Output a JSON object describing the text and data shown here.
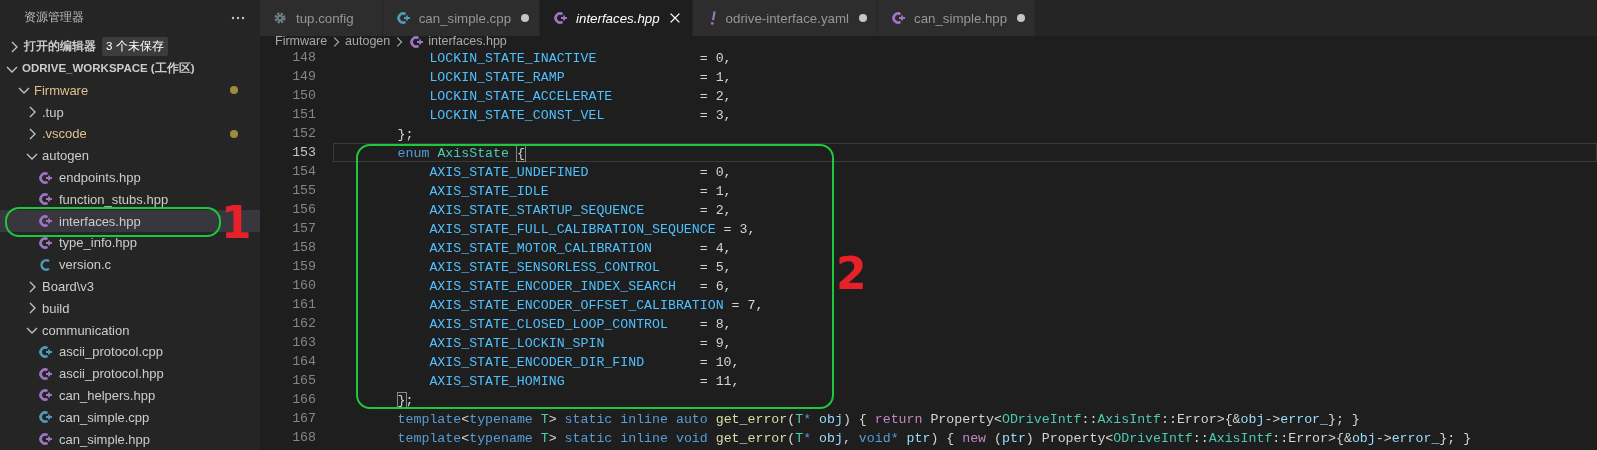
{
  "sidebar": {
    "title": "资源管理器",
    "open_editors": {
      "label": "打开的编辑器",
      "expanded": false,
      "badge": "3 个未保存"
    },
    "tree": [
      {
        "label": "ODRIVE_WORKSPACE (工作区)",
        "kind": "root",
        "expanded": true,
        "selected": false,
        "modified": false,
        "children": [
          {
            "label": "Firmware",
            "kind": "folder",
            "expanded": true,
            "selected": false,
            "modified": true,
            "children": [
              {
                "label": ".tup",
                "kind": "folder",
                "expanded": false,
                "selected": false,
                "modified": false
              },
              {
                "label": ".vscode",
                "kind": "folder",
                "expanded": false,
                "selected": false,
                "modified": true
              },
              {
                "label": "autogen",
                "kind": "folder",
                "expanded": true,
                "selected": false,
                "modified": false,
                "children": [
                  {
                    "label": "endpoints.hpp",
                    "kind": "hpp",
                    "selected": false,
                    "modified": false
                  },
                  {
                    "label": "function_stubs.hpp",
                    "kind": "hpp",
                    "selected": false,
                    "modified": false
                  },
                  {
                    "label": "interfaces.hpp",
                    "kind": "hpp",
                    "selected": true,
                    "modified": false
                  },
                  {
                    "label": "type_info.hpp",
                    "kind": "hpp",
                    "selected": false,
                    "modified": false
                  },
                  {
                    "label": "version.c",
                    "kind": "c",
                    "selected": false,
                    "modified": false
                  }
                ]
              },
              {
                "label": "Board\\v3",
                "kind": "folder",
                "expanded": false,
                "selected": false,
                "modified": false
              },
              {
                "label": "build",
                "kind": "folder",
                "expanded": false,
                "selected": false,
                "modified": false
              },
              {
                "label": "communication",
                "kind": "folder",
                "expanded": true,
                "selected": false,
                "modified": false,
                "children": [
                  {
                    "label": "ascii_protocol.cpp",
                    "kind": "cpp",
                    "selected": false,
                    "modified": false
                  },
                  {
                    "label": "ascii_protocol.hpp",
                    "kind": "hpp",
                    "selected": false,
                    "modified": false
                  },
                  {
                    "label": "can_helpers.hpp",
                    "kind": "hpp",
                    "selected": false,
                    "modified": false
                  },
                  {
                    "label": "can_simple.cpp",
                    "kind": "cpp",
                    "selected": false,
                    "modified": false
                  },
                  {
                    "label": "can_simple.hpp",
                    "kind": "hpp",
                    "selected": false,
                    "modified": false
                  }
                ]
              }
            ]
          }
        ]
      }
    ]
  },
  "tabs": [
    {
      "label": "tup.config",
      "kind": "config",
      "selected": false,
      "modified": false,
      "preview": false
    },
    {
      "label": "can_simple.cpp",
      "kind": "cpp",
      "selected": false,
      "modified": true,
      "preview": false
    },
    {
      "label": "interfaces.hpp",
      "kind": "hpp",
      "selected": true,
      "modified": false,
      "preview": true
    },
    {
      "label": "odrive-interface.yaml",
      "kind": "yaml",
      "selected": false,
      "modified": true,
      "preview": false
    },
    {
      "label": "can_simple.hpp",
      "kind": "hpp",
      "selected": false,
      "modified": true,
      "preview": false
    }
  ],
  "breadcrumb": [
    {
      "label": "Firmware"
    },
    {
      "label": "autogen"
    },
    {
      "label": "interfaces.hpp",
      "kind": "hpp"
    }
  ],
  "code": {
    "lines": [
      {
        "n": "148",
        "kind": "member",
        "current": false,
        "name": "LOCKIN_STATE_INACTIVE",
        "value": "= 0,"
      },
      {
        "n": "149",
        "kind": "member",
        "current": false,
        "name": "LOCKIN_STATE_RAMP",
        "value": "= 1,"
      },
      {
        "n": "150",
        "kind": "member",
        "current": false,
        "name": "LOCKIN_STATE_ACCELERATE",
        "value": "= 2,"
      },
      {
        "n": "151",
        "kind": "member",
        "current": false,
        "name": "LOCKIN_STATE_CONST_VEL",
        "value": "= 3,"
      },
      {
        "n": "152",
        "kind": "block",
        "current": false,
        "tokens": [
          {
            "kind": "plain",
            "text": "};"
          }
        ]
      },
      {
        "n": "153",
        "kind": "block",
        "current": true,
        "tokens": [
          {
            "kind": "kw",
            "text": "enum "
          },
          {
            "kind": "type",
            "text": "AxisState "
          },
          {
            "kind": "bracket",
            "text": "{"
          }
        ]
      },
      {
        "n": "154",
        "kind": "member",
        "current": false,
        "name": "AXIS_STATE_UNDEFINED",
        "value": "= 0,"
      },
      {
        "n": "155",
        "kind": "member",
        "current": false,
        "name": "AXIS_STATE_IDLE",
        "value": "= 1,"
      },
      {
        "n": "156",
        "kind": "member",
        "current": false,
        "name": "AXIS_STATE_STARTUP_SEQUENCE",
        "value": "= 2,"
      },
      {
        "n": "157",
        "kind": "member",
        "current": false,
        "name": "AXIS_STATE_FULL_CALIBRATION_SEQUENCE",
        "value": "= 3,"
      },
      {
        "n": "158",
        "kind": "member",
        "current": false,
        "name": "AXIS_STATE_MOTOR_CALIBRATION",
        "value": "= 4,"
      },
      {
        "n": "159",
        "kind": "member",
        "current": false,
        "name": "AXIS_STATE_SENSORLESS_CONTROL",
        "value": "= 5,"
      },
      {
        "n": "160",
        "kind": "member",
        "current": false,
        "name": "AXIS_STATE_ENCODER_INDEX_SEARCH",
        "value": "= 6,"
      },
      {
        "n": "161",
        "kind": "member",
        "current": false,
        "name": "AXIS_STATE_ENCODER_OFFSET_CALIBRATION",
        "value": "= 7,"
      },
      {
        "n": "162",
        "kind": "member",
        "current": false,
        "name": "AXIS_STATE_CLOSED_LOOP_CONTROL",
        "value": "= 8,"
      },
      {
        "n": "163",
        "kind": "member",
        "current": false,
        "name": "AXIS_STATE_LOCKIN_SPIN",
        "value": "= 9,"
      },
      {
        "n": "164",
        "kind": "member",
        "current": false,
        "name": "AXIS_STATE_ENCODER_DIR_FIND",
        "value": "= 10,"
      },
      {
        "n": "165",
        "kind": "member",
        "current": false,
        "name": "AXIS_STATE_HOMING",
        "value": "= 11,"
      },
      {
        "n": "166",
        "kind": "block",
        "current": false,
        "tokens": [
          {
            "kind": "bracket",
            "text": "}"
          },
          {
            "kind": "plain",
            "text": ";"
          }
        ]
      },
      {
        "n": "167",
        "kind": "block",
        "current": false,
        "tokens": [
          {
            "kind": "kw",
            "text": "template"
          },
          {
            "kind": "plain",
            "text": "<"
          },
          {
            "kind": "kw",
            "text": "typename "
          },
          {
            "kind": "type",
            "text": "T"
          },
          {
            "kind": "plain",
            "text": "> "
          },
          {
            "kind": "kw",
            "text": "static inline auto "
          },
          {
            "kind": "func",
            "text": "get_error"
          },
          {
            "kind": "plain",
            "text": "("
          },
          {
            "kind": "type",
            "text": "T"
          },
          {
            "kind": "kw",
            "text": "* "
          },
          {
            "kind": "param",
            "text": "obj"
          },
          {
            "kind": "plain",
            "text": ") { "
          },
          {
            "kind": "ctrl",
            "text": "return "
          },
          {
            "kind": "plain",
            "text": "Property<"
          },
          {
            "kind": "type",
            "text": "ODriveIntf"
          },
          {
            "kind": "plain",
            "text": "::"
          },
          {
            "kind": "type",
            "text": "AxisIntf"
          },
          {
            "kind": "plain",
            "text": "::Error>{&"
          },
          {
            "kind": "param",
            "text": "obj"
          },
          {
            "kind": "plain",
            "text": "->"
          },
          {
            "kind": "param",
            "text": "error_"
          },
          {
            "kind": "plain",
            "text": "}; }"
          }
        ]
      },
      {
        "n": "168",
        "kind": "block",
        "current": false,
        "tokens": [
          {
            "kind": "kw",
            "text": "template"
          },
          {
            "kind": "plain",
            "text": "<"
          },
          {
            "kind": "kw",
            "text": "typename "
          },
          {
            "kind": "type",
            "text": "T"
          },
          {
            "kind": "plain",
            "text": "> "
          },
          {
            "kind": "kw",
            "text": "static inline void "
          },
          {
            "kind": "func",
            "text": "get_error"
          },
          {
            "kind": "plain",
            "text": "("
          },
          {
            "kind": "type",
            "text": "T"
          },
          {
            "kind": "kw",
            "text": "* "
          },
          {
            "kind": "param",
            "text": "obj"
          },
          {
            "kind": "plain",
            "text": ", "
          },
          {
            "kind": "kw",
            "text": "void* "
          },
          {
            "kind": "param",
            "text": "ptr"
          },
          {
            "kind": "plain",
            "text": ") { "
          },
          {
            "kind": "ctrl",
            "text": "new "
          },
          {
            "kind": "plain",
            "text": "("
          },
          {
            "kind": "param",
            "text": "ptr"
          },
          {
            "kind": "plain",
            "text": ") Property<"
          },
          {
            "kind": "type",
            "text": "ODriveIntf"
          },
          {
            "kind": "plain",
            "text": "::"
          },
          {
            "kind": "type",
            "text": "AxisIntf"
          },
          {
            "kind": "plain",
            "text": "::Error>{&"
          },
          {
            "kind": "param",
            "text": "obj"
          },
          {
            "kind": "plain",
            "text": "->"
          },
          {
            "kind": "param",
            "text": "error_"
          },
          {
            "kind": "plain",
            "text": "}; }"
          }
        ]
      }
    ]
  },
  "annotations": [
    {
      "label": "1"
    },
    {
      "label": "2"
    }
  ]
}
